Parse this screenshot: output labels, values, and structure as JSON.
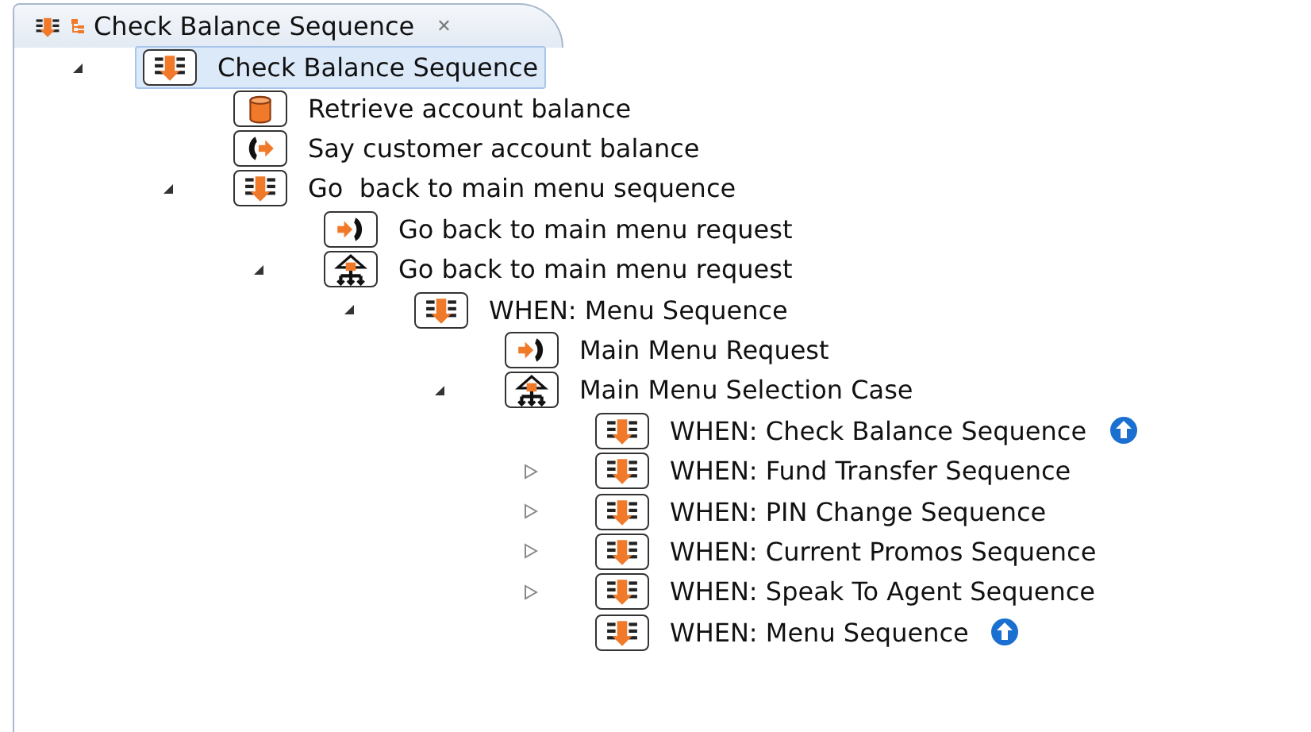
{
  "tab": {
    "title": "Check Balance Sequence",
    "close": "✕"
  },
  "tree": [
    {
      "kind": "sequence",
      "label": "Check Balance Sequence",
      "expandable": true,
      "expanded": true,
      "selected": true,
      "back_link": false,
      "children": [
        {
          "kind": "database",
          "label": "Retrieve account balance",
          "expandable": false,
          "selected": false,
          "back_link": false
        },
        {
          "kind": "say",
          "label": "Say customer account balance",
          "expandable": false,
          "selected": false,
          "back_link": false
        },
        {
          "kind": "sequence",
          "label": "Go  back to main menu sequence",
          "expandable": true,
          "expanded": true,
          "selected": false,
          "back_link": false,
          "children": [
            {
              "kind": "request",
              "label": "Go back to main menu request",
              "expandable": false,
              "selected": false,
              "back_link": false
            },
            {
              "kind": "case",
              "label": "Go back to main menu request",
              "expandable": true,
              "expanded": true,
              "selected": false,
              "back_link": false,
              "children": [
                {
                  "kind": "sequence",
                  "label": "WHEN: Menu Sequence",
                  "expandable": true,
                  "expanded": true,
                  "selected": false,
                  "back_link": false,
                  "children": [
                    {
                      "kind": "request",
                      "label": "Main Menu Request",
                      "expandable": false,
                      "selected": false,
                      "back_link": false
                    },
                    {
                      "kind": "case",
                      "label": "Main Menu Selection Case",
                      "expandable": true,
                      "expanded": true,
                      "selected": false,
                      "back_link": false,
                      "children": [
                        {
                          "kind": "sequence",
                          "label": "WHEN: Check Balance Sequence",
                          "expandable": false,
                          "selected": false,
                          "back_link": true
                        },
                        {
                          "kind": "sequence",
                          "label": "WHEN: Fund Transfer Sequence",
                          "expandable": true,
                          "expanded": false,
                          "selected": false,
                          "back_link": false
                        },
                        {
                          "kind": "sequence",
                          "label": "WHEN: PIN Change Sequence",
                          "expandable": true,
                          "expanded": false,
                          "selected": false,
                          "back_link": false
                        },
                        {
                          "kind": "sequence",
                          "label": "WHEN: Current Promos Sequence",
                          "expandable": true,
                          "expanded": false,
                          "selected": false,
                          "back_link": false
                        },
                        {
                          "kind": "sequence",
                          "label": "WHEN: Speak To Agent Sequence",
                          "expandable": true,
                          "expanded": false,
                          "selected": false,
                          "back_link": false
                        },
                        {
                          "kind": "sequence",
                          "label": "WHEN: Menu Sequence",
                          "expandable": false,
                          "selected": false,
                          "back_link": true
                        }
                      ]
                    }
                  ]
                }
              ]
            }
          ]
        }
      ]
    }
  ]
}
